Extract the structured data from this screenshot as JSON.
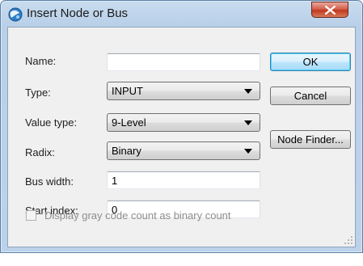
{
  "window": {
    "title": "Insert Node or Bus",
    "icons": {
      "app": "app-globe-icon",
      "close": "close-icon",
      "grip": "resize-grip-icon"
    },
    "colors": {
      "accent_border": "#3c7fb1",
      "close_button": "#c0391f"
    }
  },
  "form": {
    "name": {
      "label": "Name:",
      "value": ""
    },
    "type": {
      "label": "Type:",
      "value": "INPUT"
    },
    "value_type": {
      "label": "Value type:",
      "value": "9-Level"
    },
    "radix": {
      "label": "Radix:",
      "value": "Binary"
    },
    "bus_width": {
      "label": "Bus width:",
      "value": "1"
    },
    "start_index": {
      "label": "Start index:",
      "value": "0"
    },
    "gray_code": {
      "label": "Display gray code count as binary count",
      "checked": false,
      "enabled": false
    }
  },
  "buttons": {
    "ok": "OK",
    "cancel": "Cancel",
    "node_finder": "Node Finder..."
  }
}
